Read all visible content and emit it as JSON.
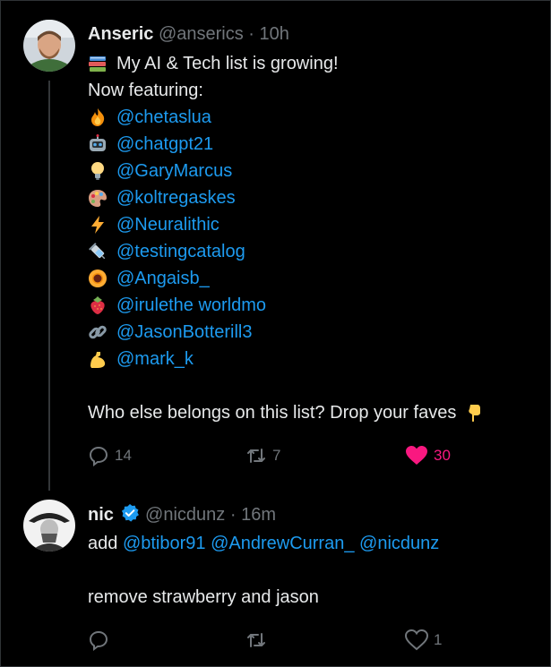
{
  "tweet1": {
    "name": "Anseric",
    "handle": "@anserics",
    "sep": "·",
    "time": "10h",
    "lines": [
      {
        "emoji": "books-emoji",
        "text": "My AI & Tech list is growing!"
      },
      {
        "text": "Now featuring:"
      },
      {
        "emoji": "fire-emoji",
        "mention": "@chetaslua"
      },
      {
        "emoji": "robot-emoji",
        "mention": "@chatgpt21"
      },
      {
        "emoji": "lightbulb-emoji",
        "mention": "@GaryMarcus"
      },
      {
        "emoji": "palette-emoji",
        "mention": "@koltregaskes"
      },
      {
        "emoji": "lightning-emoji",
        "mention": "@Neuralithic"
      },
      {
        "emoji": "syringe-emoji",
        "mention": "@testingcatalog"
      },
      {
        "emoji": "sunflower-emoji",
        "mention": "@Angaisb_"
      },
      {
        "emoji": "strawberry-emoji",
        "mention": "@irulethe worldmo"
      },
      {
        "emoji": "link-emoji",
        "mention": "@JasonBotterill3"
      },
      {
        "emoji": "flexed-biceps-emoji",
        "mention": "@mark_k"
      }
    ],
    "question": "Who else belongs on this list? Drop your faves",
    "replies": "14",
    "retweets": "7",
    "likes": "30"
  },
  "tweet2": {
    "name": "nic",
    "handle": "@nicdunz",
    "sep": "·",
    "time": "16m",
    "add_word": "add",
    "mentions": [
      "@btibor91",
      "@AndrewCurran_",
      "@nicdunz"
    ],
    "second_line": "remove strawberry and jason",
    "likes": "1"
  },
  "colors": {
    "accent": "#1d9bf0",
    "like": "#f91880",
    "muted": "#71767b",
    "text": "#e7e9ea"
  }
}
